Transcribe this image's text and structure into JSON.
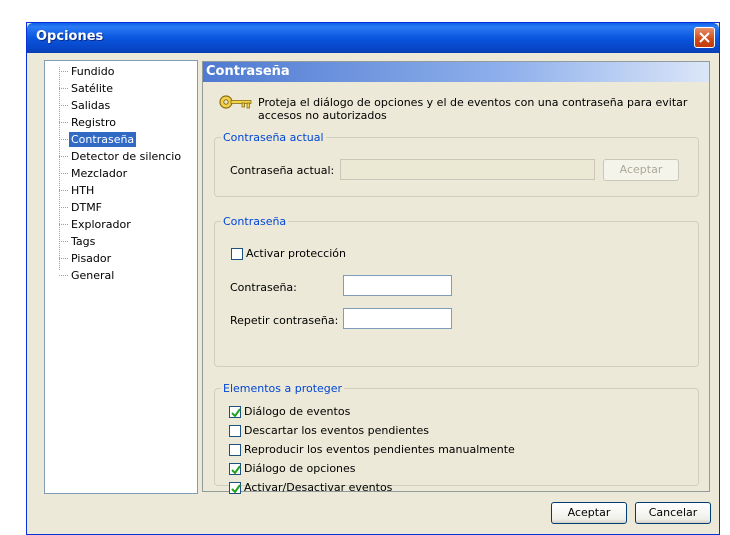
{
  "window": {
    "title": "Opciones"
  },
  "tree": {
    "items": [
      {
        "label": "Fundido"
      },
      {
        "label": "Satélite"
      },
      {
        "label": "Salidas"
      },
      {
        "label": "Registro"
      },
      {
        "label": "Contraseña"
      },
      {
        "label": "Detector de silencio"
      },
      {
        "label": "Mezclador"
      },
      {
        "label": "HTH"
      },
      {
        "label": "DTMF"
      },
      {
        "label": "Explorador"
      },
      {
        "label": "Tags"
      },
      {
        "label": "Pisador"
      },
      {
        "label": "General"
      }
    ],
    "selected": "Contraseña"
  },
  "panel": {
    "title": "Contraseña",
    "description": "Proteja el diálogo de opciones y el de eventos con una contraseña para evitar accesos no autorizados",
    "key_icon": "key-icon"
  },
  "current_password": {
    "group_title": "Contraseña actual",
    "label": "Contraseña actual:",
    "value": "",
    "button_label": "Aceptar"
  },
  "password": {
    "group_title": "Contraseña",
    "activate_label": "Activar protección",
    "activate_checked": false,
    "password_label": "Contraseña:",
    "password_value": "",
    "repeat_label": "Repetir contraseña:",
    "repeat_value": ""
  },
  "protect": {
    "group_title": "Elementos a proteger",
    "items": [
      {
        "label": "Diálogo de eventos",
        "checked": true
      },
      {
        "label": "Descartar los eventos pendientes",
        "checked": false
      },
      {
        "label": "Reproducir los eventos pendientes manualmente",
        "checked": false
      },
      {
        "label": "Diálogo de opciones",
        "checked": true
      },
      {
        "label": "Activar/Desactivar eventos",
        "checked": true
      }
    ]
  },
  "footer": {
    "ok_label": "Aceptar",
    "cancel_label": "Cancelar"
  },
  "colors": {
    "titlebar": "#0a56de",
    "selection": "#316ac5",
    "group_title": "#0046d5",
    "face": "#ece9d8"
  }
}
